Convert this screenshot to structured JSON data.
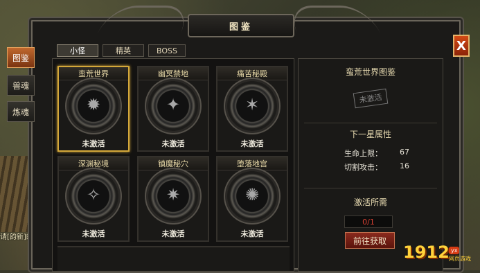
{
  "title": "图鉴",
  "close_label": "X",
  "side_tabs": [
    {
      "label": "图鉴",
      "active": true
    },
    {
      "label": "兽魂",
      "active": false
    },
    {
      "label": "炼魂",
      "active": false
    }
  ],
  "top_tabs": [
    {
      "label": "小怪",
      "active": true
    },
    {
      "label": "精英",
      "active": false
    },
    {
      "label": "BOSS",
      "active": false
    }
  ],
  "cards": [
    {
      "name": "蛮荒世界",
      "status": "未激活",
      "selected": true,
      "icon": "crab-creature-icon"
    },
    {
      "name": "幽冥禁地",
      "status": "未激活",
      "selected": false,
      "icon": "beetle-creature-icon"
    },
    {
      "name": "痛苦秘殿",
      "status": "未激活",
      "selected": false,
      "icon": "skeleton-creature-icon"
    },
    {
      "name": "深渊秘境",
      "status": "未激活",
      "selected": false,
      "icon": "bird-creature-icon"
    },
    {
      "name": "镇魔秘穴",
      "status": "未激活",
      "selected": false,
      "icon": "demon-creature-icon"
    },
    {
      "name": "堕落地宫",
      "status": "未激活",
      "selected": false,
      "icon": "spider-creature-icon"
    }
  ],
  "panel": {
    "title": "蛮荒世界图鉴",
    "stamp": "未激活",
    "next_star_title": "下一星属性",
    "attributes": [
      {
        "label": "生命上限：",
        "value": "67"
      },
      {
        "label": "切割攻击：",
        "value": "16"
      }
    ],
    "require_title": "激活所需",
    "progress": "0/1",
    "go_button": "前往获取"
  },
  "background_text": "请[韵新]的[砺.",
  "logo": {
    "main": "1912",
    "badge": "yx",
    "sub": "网页游戏"
  }
}
